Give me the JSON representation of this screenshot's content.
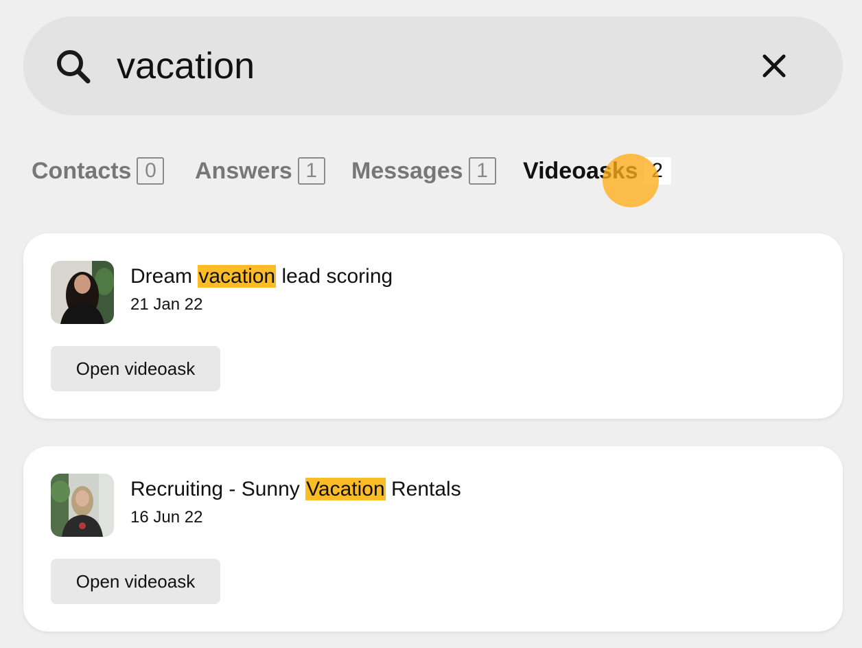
{
  "search": {
    "value": "vacation",
    "icon": "search-icon",
    "clear_icon": "close-icon"
  },
  "tabs": [
    {
      "label": "Contacts",
      "count": "0",
      "active": false
    },
    {
      "label": "Answers",
      "count": "1",
      "active": false
    },
    {
      "label": "Messages",
      "count": "1",
      "active": false
    },
    {
      "label": "Videoasks",
      "count": "2",
      "active": true
    }
  ],
  "results": [
    {
      "title_before": "Dream ",
      "title_highlight": "vacation",
      "title_after": " lead scoring",
      "date": "21 Jan 22",
      "button_label": "Open videoask"
    },
    {
      "title_before": "Recruiting - Sunny ",
      "title_highlight": "Vacation",
      "title_after": " Rentals",
      "date": "16 Jun 22",
      "button_label": "Open videoask"
    }
  ],
  "colors": {
    "highlight": "#fcbc26",
    "cursor": "#ffad1a",
    "background": "#efefef",
    "search_bg": "#e3e3e3"
  }
}
